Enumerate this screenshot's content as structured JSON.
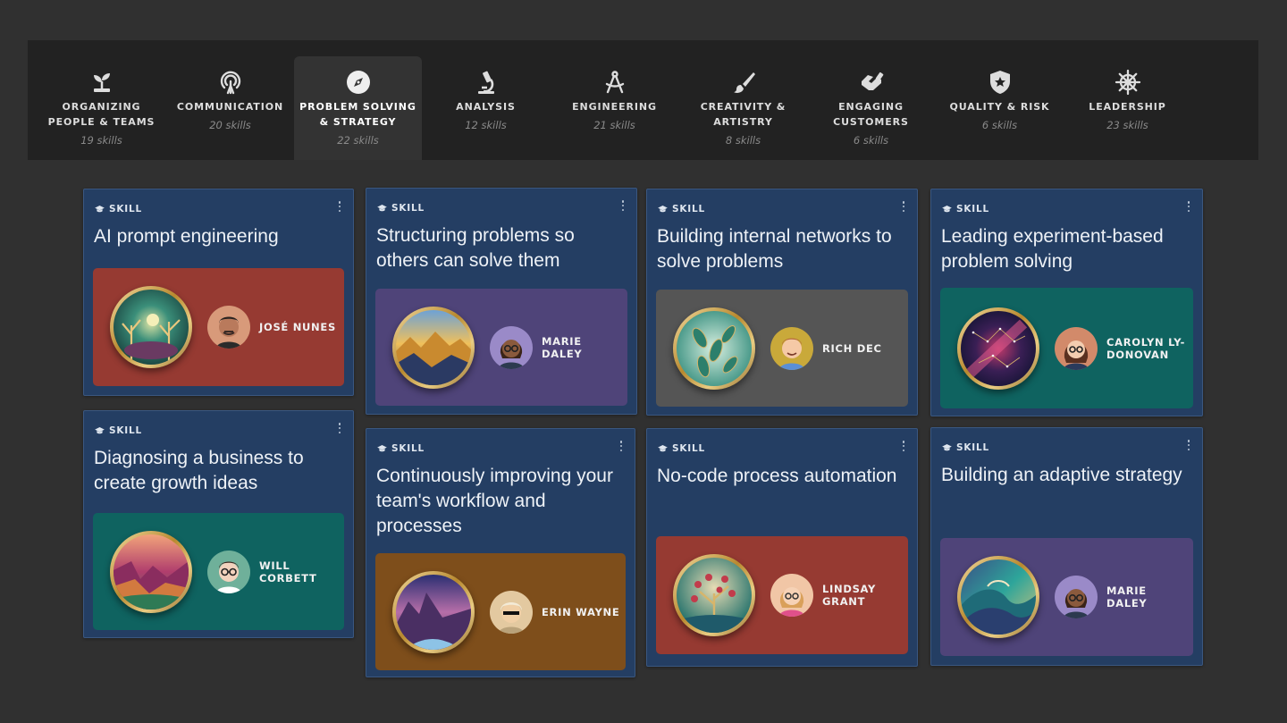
{
  "categories": [
    {
      "name": "ORGANIZING PEOPLE & TEAMS",
      "count": "19 skills",
      "icon": "sprout-icon"
    },
    {
      "name": "COMMUNICATION",
      "count": "20 skills",
      "icon": "broadcast-icon"
    },
    {
      "name": "PROBLEM SOLVING & STRATEGY",
      "count": "22 skills",
      "icon": "compass-icon",
      "active": true
    },
    {
      "name": "ANALYSIS",
      "count": "12 skills",
      "icon": "microscope-icon"
    },
    {
      "name": "ENGINEERING",
      "count": "21 skills",
      "icon": "drafting-compass-icon"
    },
    {
      "name": "CREATIVITY & ARTISTRY",
      "count": "8 skills",
      "icon": "paintbrush-icon"
    },
    {
      "name": "ENGAGING CUSTOMERS",
      "count": "6 skills",
      "icon": "handshake-icon"
    },
    {
      "name": "QUALITY & RISK",
      "count": "6 skills",
      "icon": "shield-star-icon"
    },
    {
      "name": "LEADERSHIP",
      "count": "23 skills",
      "icon": "ship-wheel-icon"
    }
  ],
  "skills": [
    {
      "kind": "SKILL",
      "title": "AI prompt engineering",
      "owner": "JOSÉ NUNES",
      "panel_color": "#963a32",
      "badge": "enchanted-forest"
    },
    {
      "kind": "SKILL",
      "title": "Diagnosing a business to create growth ideas",
      "owner": "WILL CORBETT",
      "panel_color": "#0f6360",
      "badge": "canyon"
    },
    {
      "kind": "SKILL",
      "title": "Structuring problems so others can solve them",
      "owner": "MARIE DALEY",
      "panel_color": "#4f4479",
      "badge": "mountain-sunset"
    },
    {
      "kind": "SKILL",
      "title": "Continuously improving your team's workflow and processes",
      "owner": "ERIN WAYNE",
      "panel_color": "#7e4e1b",
      "badge": "night-valley"
    },
    {
      "kind": "SKILL",
      "title": "Building internal networks to solve problems",
      "owner": "RICH DEC",
      "panel_color": "#555555",
      "badge": "leaves"
    },
    {
      "kind": "SKILL",
      "title": "No-code process automation",
      "owner": "LINDSAY GRANT",
      "panel_color": "#963a32",
      "badge": "fruit-tree"
    },
    {
      "kind": "SKILL",
      "title": "Leading experiment-based problem solving",
      "owner": "CAROLYN LY-DONOVAN",
      "panel_color": "#0f6360",
      "badge": "constellation"
    },
    {
      "kind": "SKILL",
      "title": "Building an adaptive strategy",
      "owner": "MARIE DALEY",
      "panel_color": "#4f4479",
      "badge": "ocean-wave"
    }
  ]
}
